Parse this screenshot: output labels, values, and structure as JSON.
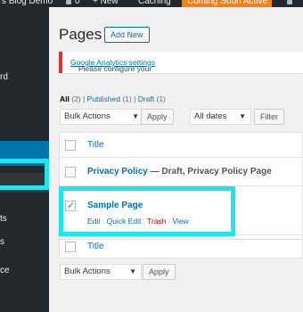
{
  "admin_bar": {
    "site_name": "'s Blog Demo",
    "comments_count": "0",
    "new_label": "+ New",
    "caching_label": "Caching",
    "coming_soon_label": "Coming Soon Active",
    "coming_soon_color": "#f0821e"
  },
  "sidebar": {
    "item_fragment_1": "rd",
    "item_fragment_2": "ts",
    "item_fragment_3": "s",
    "item_fragment_4": "ce",
    "active_color": "#0073aa"
  },
  "header": {
    "title": "Pages",
    "add_new": "Add New"
  },
  "notice": {
    "prefix": "Please configure your ",
    "link": "Google Analytics settings",
    "suffix": "!"
  },
  "views": {
    "all": "All",
    "all_count": "(2)",
    "published": "Published",
    "published_count": "(1)",
    "draft": "Draft",
    "draft_count": "(1)",
    "sep": "|"
  },
  "top_actions": {
    "bulk": "Bulk Actions",
    "apply": "Apply",
    "dates": "All dates",
    "filter": "Filter"
  },
  "table": {
    "header_title": "Title",
    "footer_title": "Title",
    "rows": [
      {
        "title": "Privacy Policy",
        "state": " — Draft, Privacy Policy Page"
      },
      {
        "title": "Sample Page",
        "actions": [
          "Edit",
          "Quick Edit",
          "Trash",
          "View"
        ]
      }
    ]
  },
  "bottom_actions": {
    "bulk": "Bulk Actions",
    "apply": "Apply"
  },
  "highlight_color": "#1ee6ee"
}
